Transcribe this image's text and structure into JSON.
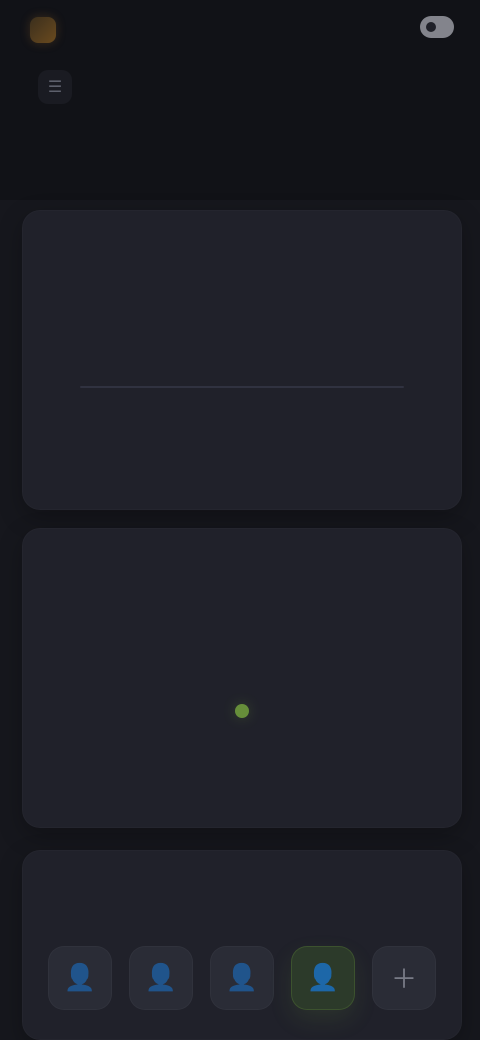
{
  "app": {
    "brand_name": "",
    "header_link": "",
    "page_title": ""
  },
  "cards": [
    {
      "title": "",
      "empty_state_label": ""
    },
    {
      "title": ""
    },
    {
      "title": "",
      "items": [
        {
          "label": "",
          "icon": "user-icon"
        },
        {
          "label": "",
          "icon": "user-icon"
        },
        {
          "label": "",
          "icon": "user-icon"
        },
        {
          "label": "",
          "icon": "user-icon",
          "active": true
        },
        {
          "label": "",
          "icon": "plus-icon"
        }
      ]
    }
  ],
  "colors": {
    "background": "#16171d",
    "header_background": "#111217",
    "card_background": "#20212a",
    "accent_green": "#7fb546",
    "brand_tint": "#a08457"
  }
}
